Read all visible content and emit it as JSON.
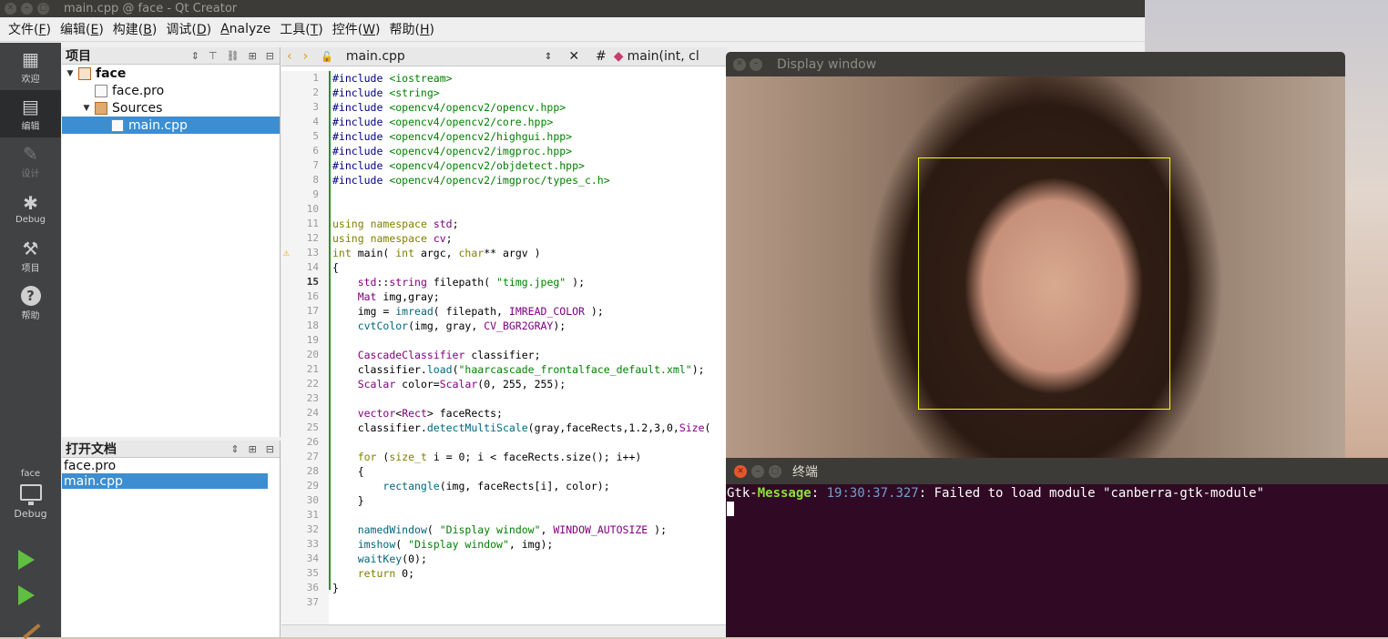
{
  "window": {
    "title": "main.cpp @ face - Qt Creator"
  },
  "menubar": {
    "items": [
      {
        "label": "文件(",
        "key": "F",
        "tail": ")"
      },
      {
        "label": "编辑(",
        "key": "E",
        "tail": ")"
      },
      {
        "label": "构建(",
        "key": "B",
        "tail": ")"
      },
      {
        "label": "调试(",
        "key": "D",
        "tail": ")"
      },
      {
        "label": "",
        "key": "A",
        "tail": "nalyze"
      },
      {
        "label": "工具(",
        "key": "T",
        "tail": ")"
      },
      {
        "label": "控件(",
        "key": "W",
        "tail": ")"
      },
      {
        "label": "帮助(",
        "key": "H",
        "tail": ")"
      }
    ]
  },
  "sidebar": {
    "modes": [
      {
        "label": "欢迎",
        "icon": "grid-icon",
        "state": "normal"
      },
      {
        "label": "编辑",
        "icon": "edit-icon",
        "state": "active"
      },
      {
        "label": "设计",
        "icon": "pencil-icon",
        "state": "disabled"
      },
      {
        "label": "Debug",
        "icon": "bug-icon",
        "state": "normal"
      },
      {
        "label": "项目",
        "icon": "wrench-icon",
        "state": "normal"
      },
      {
        "label": "帮助",
        "icon": "help-icon",
        "state": "normal"
      }
    ],
    "target_project": "face",
    "target_config": "Debug"
  },
  "projects_pane": {
    "title": "项目",
    "tree": [
      {
        "label": "face",
        "level": 0,
        "expanded": true,
        "icon": "project-icon",
        "bold": true
      },
      {
        "label": "face.pro",
        "level": 1,
        "icon": "pro-file-icon"
      },
      {
        "label": "Sources",
        "level": 1,
        "expanded": true,
        "icon": "folder-icon"
      },
      {
        "label": "main.cpp",
        "level": 2,
        "icon": "cpp-file-icon",
        "selected": true
      }
    ]
  },
  "open_docs_pane": {
    "title": "打开文档",
    "items": [
      {
        "label": "face.pro",
        "selected": false
      },
      {
        "label": "main.cpp",
        "selected": true
      }
    ]
  },
  "editor": {
    "file_tab": "main.cpp",
    "symbol": "main(int, cl",
    "hash": "#",
    "current_line": 15,
    "warning_line": 13,
    "lines": [
      "#include <iostream>",
      "#include <string>",
      "#include <opencv4/opencv2/opencv.hpp>",
      "#include <opencv4/opencv2/core.hpp>",
      "#include <opencv4/opencv2/highgui.hpp>",
      "#include <opencv4/opencv2/imgproc.hpp>",
      "#include <opencv4/opencv2/objdetect.hpp>",
      "#include <opencv4/opencv2/imgproc/types_c.h>",
      "",
      "",
      "using namespace std;",
      "using namespace cv;",
      "int main( int argc, char** argv )",
      "{",
      "    std::string filepath( \"timg.jpeg\" );",
      "    Mat img,gray;",
      "    img = imread( filepath, IMREAD_COLOR );",
      "    cvtColor(img, gray, CV_BGR2GRAY);",
      "",
      "    CascadeClassifier classifier;",
      "    classifier.load(\"haarcascade_frontalface_default.xml\");",
      "    Scalar color=Scalar(0, 255, 255);",
      "",
      "    vector<Rect> faceRects;",
      "    classifier.detectMultiScale(gray,faceRects,1.2,3,0,Size(",
      "",
      "    for (size_t i = 0; i < faceRects.size(); i++)",
      "    {",
      "        rectangle(img, faceRects[i], color);",
      "    }",
      "",
      "    namedWindow( \"Display window\", WINDOW_AUTOSIZE );",
      "    imshow( \"Display window\", img);",
      "    waitKey(0);",
      "    return 0;",
      "}",
      ""
    ]
  },
  "display_window": {
    "title": "Display window",
    "face_rect_color": "#ffff00"
  },
  "terminal": {
    "title": "终端",
    "prefix": "Gtk-",
    "level": "Message",
    "sep": ": ",
    "time": "19:30:37.327",
    "message": ": Failed to load module \"canberra-gtk-module\""
  },
  "colors": {
    "sidebar": "#404244",
    "selection": "#3d8ed0",
    "terminal_bg": "#300a24",
    "face_rect": "#ffff00"
  }
}
